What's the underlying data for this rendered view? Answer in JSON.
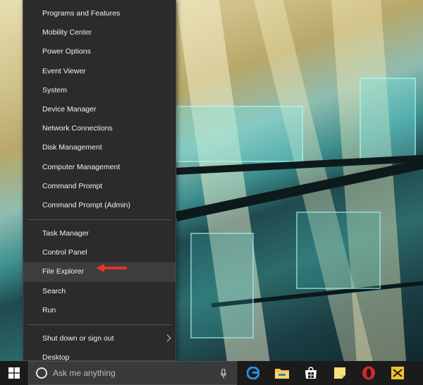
{
  "menu": {
    "group1": [
      {
        "label": "Programs and Features"
      },
      {
        "label": "Mobility Center"
      },
      {
        "label": "Power Options"
      },
      {
        "label": "Event Viewer"
      },
      {
        "label": "System"
      },
      {
        "label": "Device Manager"
      },
      {
        "label": "Network Connections"
      },
      {
        "label": "Disk Management"
      },
      {
        "label": "Computer Management"
      },
      {
        "label": "Command Prompt"
      },
      {
        "label": "Command Prompt (Admin)"
      }
    ],
    "group2": [
      {
        "label": "Task Manager"
      },
      {
        "label": "Control Panel"
      },
      {
        "label": "File Explorer"
      },
      {
        "label": "Search"
      },
      {
        "label": "Run"
      }
    ],
    "group3": [
      {
        "label": "Shut down or sign out"
      },
      {
        "label": "Desktop"
      }
    ],
    "highlighted_item": "File Explorer"
  },
  "taskbar": {
    "search_placeholder": "Ask me anything",
    "pinned_icons": [
      "edge-icon",
      "file-explorer-icon",
      "store-icon",
      "sticky-notes-icon",
      "opera-icon",
      "yellow-app-icon"
    ]
  },
  "colors": {
    "menu_bg": "#2b2b2b",
    "menu_highlight": "#3d3d3d",
    "taskbar_bg": "#1b1b1b",
    "annotation_arrow": "#e0352b"
  }
}
